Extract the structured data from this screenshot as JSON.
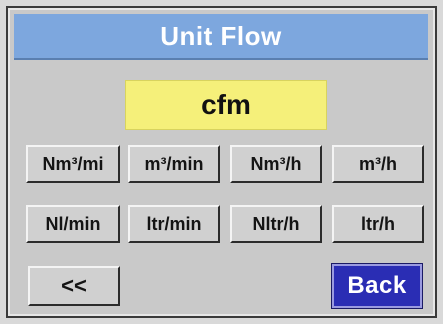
{
  "screen": {
    "title": "Unit Flow",
    "current_unit": "cfm"
  },
  "unit_buttons": {
    "row1": [
      "Nm³/mi",
      "m³/min",
      "Nm³/h",
      "m³/h"
    ],
    "row2": [
      "Nl/min",
      "ltr/min",
      "Nltr/h",
      "ltr/h"
    ]
  },
  "nav": {
    "prev_label": "<<",
    "back_label": "Back"
  },
  "colors": {
    "title_bar": "#7da7de",
    "current_unit_bg": "#f5f07a",
    "back_button_bg": "#2a2db4",
    "panel_bg": "#c9c9c9"
  }
}
